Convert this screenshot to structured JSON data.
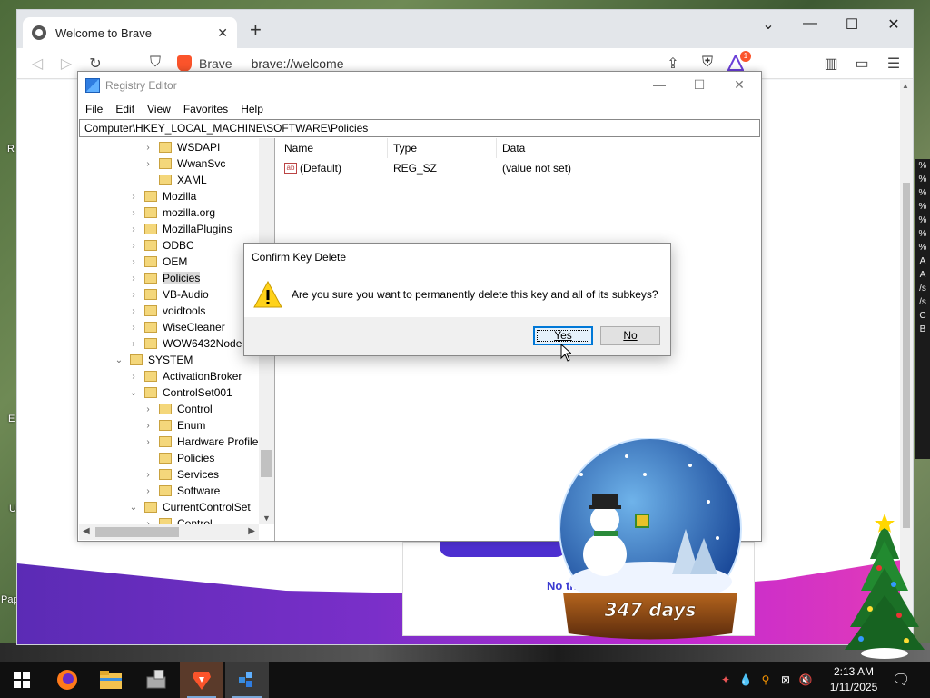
{
  "desktop": {
    "labels": [
      "R",
      "E",
      "U",
      "Pap"
    ],
    "side_chars": [
      "%",
      "%",
      "%",
      "%",
      "%",
      "%",
      "%",
      "A",
      "A",
      "/s",
      "/s",
      "C",
      "B"
    ]
  },
  "browser": {
    "tab_title": "Welcome to Brave",
    "url_site": "Brave",
    "url_text": "brave://welcome",
    "rewards_badge": "1",
    "welcome_link": "No th"
  },
  "regedit": {
    "title": "Registry Editor",
    "menu": [
      "File",
      "Edit",
      "View",
      "Favorites",
      "Help"
    ],
    "address": "Computer\\HKEY_LOCAL_MACHINE\\SOFTWARE\\Policies",
    "tree": [
      {
        "name": "WSDAPI",
        "level": 2,
        "expander": ">"
      },
      {
        "name": "WwanSvc",
        "level": 2,
        "expander": ">"
      },
      {
        "name": "XAML",
        "level": 2,
        "expander": ""
      },
      {
        "name": "Mozilla",
        "level": 1,
        "expander": ">"
      },
      {
        "name": "mozilla.org",
        "level": 1,
        "expander": ">"
      },
      {
        "name": "MozillaPlugins",
        "level": 1,
        "expander": ">"
      },
      {
        "name": "ODBC",
        "level": 1,
        "expander": ">"
      },
      {
        "name": "OEM",
        "level": 1,
        "expander": ">"
      },
      {
        "name": "Policies",
        "level": 1,
        "expander": ">",
        "selected": true
      },
      {
        "name": "VB-Audio",
        "level": 1,
        "expander": ">"
      },
      {
        "name": "voidtools",
        "level": 1,
        "expander": ">"
      },
      {
        "name": "WiseCleaner",
        "level": 1,
        "expander": ">"
      },
      {
        "name": "WOW6432Node",
        "level": 1,
        "expander": ">"
      },
      {
        "name": "SYSTEM",
        "level": 0,
        "expander": "v"
      },
      {
        "name": "ActivationBroker",
        "level": 1,
        "expander": ">"
      },
      {
        "name": "ControlSet001",
        "level": 1,
        "expander": "v"
      },
      {
        "name": "Control",
        "level": 2,
        "expander": ">"
      },
      {
        "name": "Enum",
        "level": 2,
        "expander": ">"
      },
      {
        "name": "Hardware Profiles",
        "level": 2,
        "expander": ">"
      },
      {
        "name": "Policies",
        "level": 2,
        "expander": ""
      },
      {
        "name": "Services",
        "level": 2,
        "expander": ">"
      },
      {
        "name": "Software",
        "level": 2,
        "expander": ">"
      },
      {
        "name": "CurrentControlSet",
        "level": 1,
        "expander": "v"
      },
      {
        "name": "Control",
        "level": 2,
        "expander": ">"
      }
    ],
    "columns": [
      "Name",
      "Type",
      "Data"
    ],
    "values": [
      {
        "name": "(Default)",
        "type": "REG_SZ",
        "data": "(value not set)"
      }
    ]
  },
  "dialog": {
    "title": "Confirm Key Delete",
    "message": "Are you sure you want to permanently delete this key and all of its subkeys?",
    "yes_label": "Yes",
    "no_label": "No"
  },
  "snowglobe": {
    "countdown": "347 days"
  },
  "taskbar": {
    "apps": [
      "firefox-icon",
      "file-explorer-icon",
      "drive-tool-icon",
      "brave-icon",
      "registry-editor-icon"
    ],
    "time": "2:13 AM",
    "date": "1/11/2025"
  },
  "colors": {
    "brave_orange": "#fb542b",
    "windows_blue": "#0078d7",
    "welcome_purple": "#5b2bb5"
  }
}
